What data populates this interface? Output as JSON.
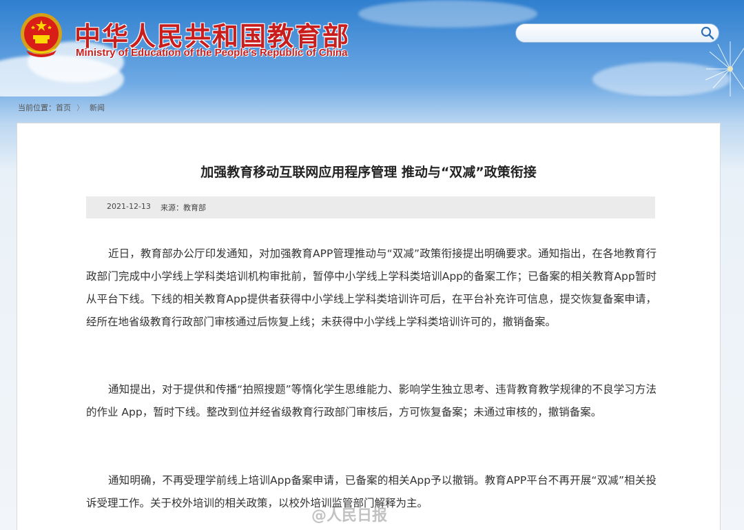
{
  "header": {
    "title_cn": "中华人民共和国教育部",
    "title_en": "Ministry of Education of the People's Republic of China",
    "emblem_icon": "national-emblem-icon",
    "colors": {
      "title": "#c81e1e",
      "sky_top": "#2f7fcf",
      "sky_bottom": "#e9f1f8"
    }
  },
  "search": {
    "placeholder": "",
    "icon": "search-icon"
  },
  "breadcrumb": {
    "label": "当前位置：",
    "home": "首页",
    "separator": "〉",
    "current": "新闻"
  },
  "article": {
    "title": "加强教育移动互联网应用程序管理 推动与“双减”政策衔接",
    "date": "2021-12-13",
    "source": "来源：教育部",
    "paragraphs": [
      "近日，教育部办公厅印发通知，对加强教育APP管理推动与“双减”政策衔接提出明确要求。通知指出，在各地教育行政部门完成中小学线上学科类培训机构审批前，暂停中小学线上学科类培训App的备案工作；已备案的相关教育App暂时从平台下线。下线的相关教育App提供者获得中小学线上学科类培训许可后，在平台补充许可信息，提交恢复备案申请，经所在地省级教育行政部门审核通过后恢复上线；未获得中小学线上学科类培训许可的，撤销备案。",
      "通知提出，对于提供和传播“拍照搜题”等惰化学生思维能力、影响学生独立思考、违背教育教学规律的不良学习方法的作业 App，暂时下线。整改到位并经省级教育行政部门审核后，方可恢复备案；未通过审核的，撤销备案。",
      "通知明确，不再受理学前线上培训App备案申请，已备案的相关App予以撤销。教育APP平台不再开展“双减”相关投诉受理工作。关于校外培训的相关政策，以校外培训监管部门解释为主。"
    ]
  },
  "watermark": {
    "text": "@人民日报"
  }
}
